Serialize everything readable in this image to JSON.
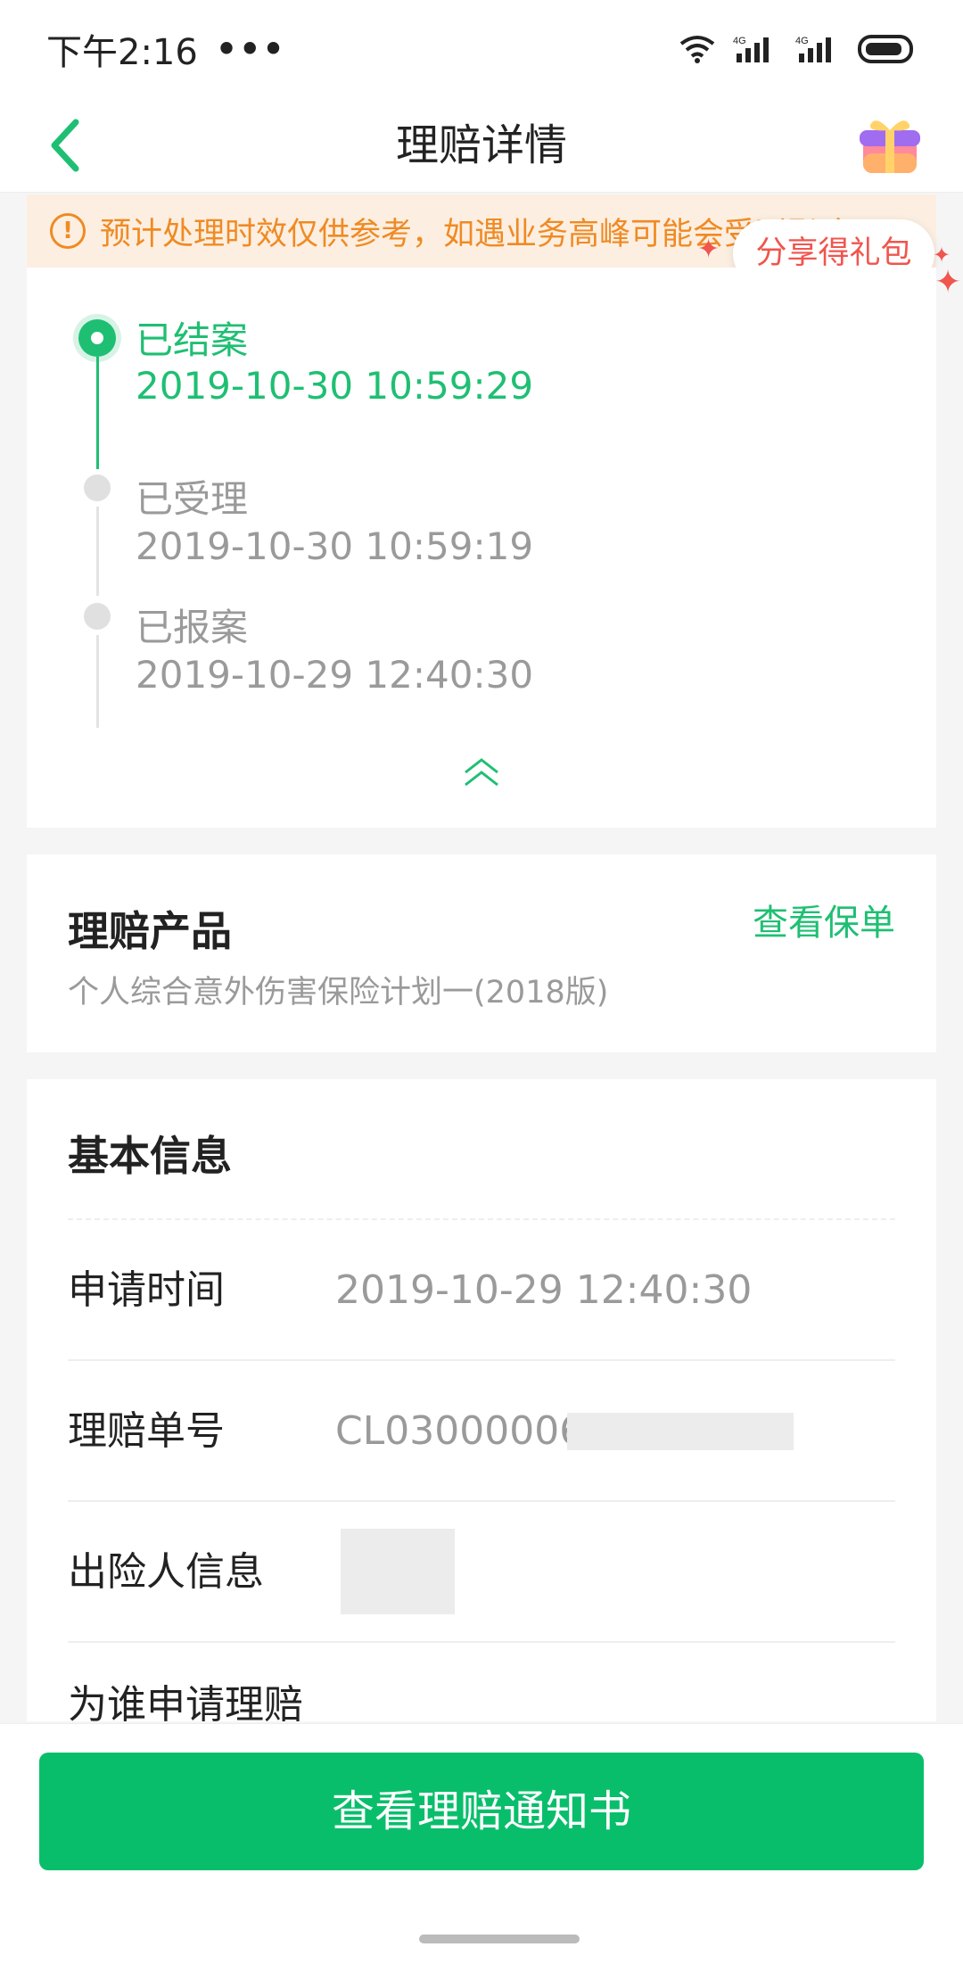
{
  "status_bar": {
    "time": "下午2:16",
    "dots": "•••",
    "icons": [
      "wifi-icon",
      "signal-4g-icon",
      "signal-4g-icon",
      "battery-icon"
    ]
  },
  "navbar": {
    "title": "理赔详情",
    "back_icon": "chevron-left-icon",
    "gift_icon": "gift-box-icon"
  },
  "notice": {
    "text": "预计处理时效仅供参考，如遇业务高峰可能会受到影响",
    "icon": "alert-circle-icon"
  },
  "share": {
    "label": "分享得礼包"
  },
  "timeline": {
    "items": [
      {
        "status": "已结案",
        "time": "2019-10-30 10:59:29",
        "active": true
      },
      {
        "status": "已受理",
        "time": "2019-10-30 10:59:19",
        "active": false
      },
      {
        "status": "已报案",
        "time": "2019-10-29 12:40:30",
        "active": false
      }
    ],
    "collapse_icon": "chevron-double-up-icon"
  },
  "product": {
    "title": "理赔产品",
    "view_policy_label": "查看保单",
    "name": "个人综合意外伤害保险计划一(2018版)"
  },
  "basic_info": {
    "title": "基本信息",
    "rows": [
      {
        "label": "申请时间",
        "value": "2019-10-29 12:40:30"
      },
      {
        "label": "理赔单号",
        "value": "CL03000006"
      },
      {
        "label": "出险人信息",
        "value": ""
      },
      {
        "label": "为谁申请理赔",
        "value": ""
      }
    ]
  },
  "bottom": {
    "button_label": "查看理赔通知书"
  },
  "colors": {
    "primary_green": "#09be6b",
    "accent_green": "#1fbf73",
    "notice_orange": "#f08a24",
    "notice_bg": "#fcefe1",
    "share_red": "#f0554e"
  }
}
